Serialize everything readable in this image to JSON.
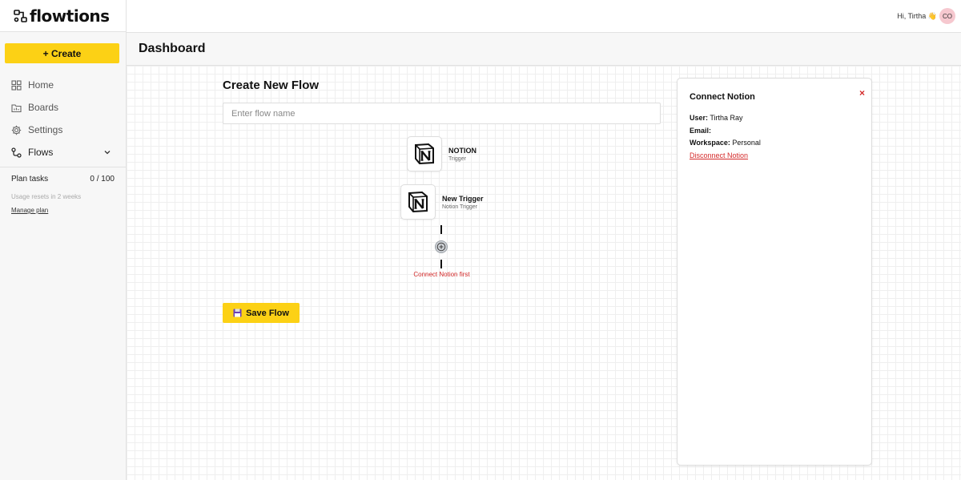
{
  "app": {
    "name": "flowtions"
  },
  "sidebar": {
    "create_label": "+ Create",
    "items": [
      {
        "label": "Home",
        "icon": "home-icon"
      },
      {
        "label": "Boards",
        "icon": "boards-icon"
      },
      {
        "label": "Settings",
        "icon": "gear-icon"
      },
      {
        "label": "Flows",
        "icon": "flows-icon"
      }
    ],
    "plan": {
      "label": "Plan tasks",
      "count": "0 / 100",
      "reset_note": "Usage resets in 2 weeks",
      "manage_label": "Manage plan"
    }
  },
  "topbar": {
    "greeting": "Hi, Tirtha 👋",
    "avatar_initials": "CO"
  },
  "header": {
    "title": "Dashboard"
  },
  "main": {
    "title": "Create New Flow",
    "flow_name_placeholder": "Enter flow name",
    "flow_name_value": "",
    "nodes": [
      {
        "title": "NOTION",
        "subtitle": "Trigger",
        "icon": "notion-icon"
      },
      {
        "title": "New Trigger",
        "subtitle": "Notion Trigger",
        "icon": "notion-icon"
      }
    ],
    "warning": "Connect Notion first",
    "save_label": "Save Flow"
  },
  "panel": {
    "title": "Connect Notion",
    "close": "×",
    "user_label": "User:",
    "user_value": "Tirtha Ray",
    "email_label": "Email:",
    "email_value": "",
    "workspace_label": "Workspace:",
    "workspace_value": "Personal",
    "disconnect_label": "Disconnect Notion"
  },
  "colors": {
    "accent": "#fcd115",
    "danger": "#d42a2a",
    "avatar_bg": "#f6c8cf"
  }
}
